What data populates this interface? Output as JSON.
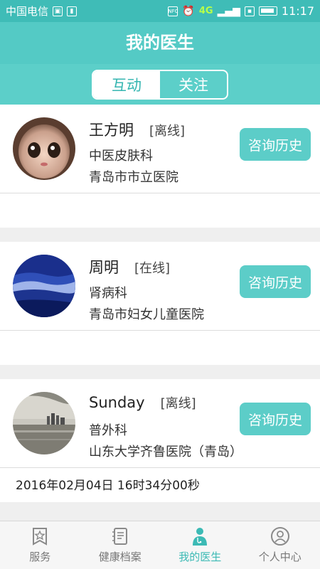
{
  "status_bar": {
    "carrier": "中国电信",
    "sim_icon": "sim-icon",
    "nfc": "NFC",
    "network": "4G",
    "time": "11:17"
  },
  "header": {
    "title": "我的医生"
  },
  "segment": {
    "tabs": [
      {
        "label": "互动",
        "active": true
      },
      {
        "label": "关注",
        "active": false
      }
    ]
  },
  "doctors": [
    {
      "name": "王方明",
      "status": "[离线]",
      "department": "中医皮肤科",
      "hospital": "青岛市市立医院",
      "button": "咨询历史",
      "footer": ""
    },
    {
      "name": "周明",
      "status": "[在线]",
      "department": "肾病科",
      "hospital": "青岛市妇女儿童医院",
      "button": "咨询历史",
      "footer": ""
    },
    {
      "name": "Sunday",
      "status": "[离线]",
      "department": "普外科",
      "hospital": "山东大学齐鲁医院（青岛）",
      "button": "咨询历史",
      "footer": "2016年02月04日 16时34分00秒"
    }
  ],
  "bottom_nav": [
    {
      "label": "服务",
      "icon": "star-bookmark-icon",
      "active": false
    },
    {
      "label": "健康档案",
      "icon": "record-book-icon",
      "active": false
    },
    {
      "label": "我的医生",
      "icon": "doctor-icon",
      "active": true
    },
    {
      "label": "个人中心",
      "icon": "person-icon",
      "active": false
    }
  ],
  "colors": {
    "accent": "#54cac5",
    "button": "#5ccdc8",
    "active_nav": "#3cbab5"
  }
}
